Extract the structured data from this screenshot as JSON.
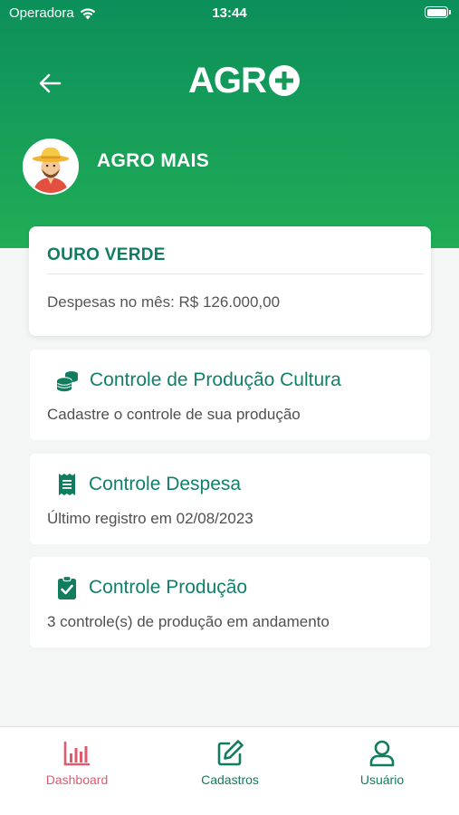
{
  "status_bar": {
    "carrier": "Operadora",
    "time": "13:44"
  },
  "header": {
    "logo_text": "AGR",
    "org_name": "AGRO MAIS"
  },
  "summary": {
    "title": "OURO VERDE",
    "expenses_text": "Despesas no mês: R$ 126.000,00"
  },
  "cards": [
    {
      "icon": "coins-icon",
      "title": "Controle de Produção Cultura",
      "description": "Cadastre o controle de sua produção"
    },
    {
      "icon": "receipt-icon",
      "title": "Controle Despesa",
      "description": "Último registro em 02/08/2023"
    },
    {
      "icon": "clipboard-check-icon",
      "title": "Controle Produção",
      "description": "3 controle(s) de produção em andamento"
    }
  ],
  "tabbar": {
    "items": [
      {
        "label": "Dashboard",
        "icon": "bar-chart-icon",
        "active": true
      },
      {
        "label": "Cadastros",
        "icon": "edit-icon",
        "active": false
      },
      {
        "label": "Usuário",
        "icon": "user-icon",
        "active": false
      }
    ]
  },
  "colors": {
    "header_gradient_top": "#0c8f5a",
    "header_gradient_bottom": "#21ad55",
    "accent_green": "#127c5f",
    "active_tab": "#e05a6d",
    "background": "#f4f5f5"
  }
}
